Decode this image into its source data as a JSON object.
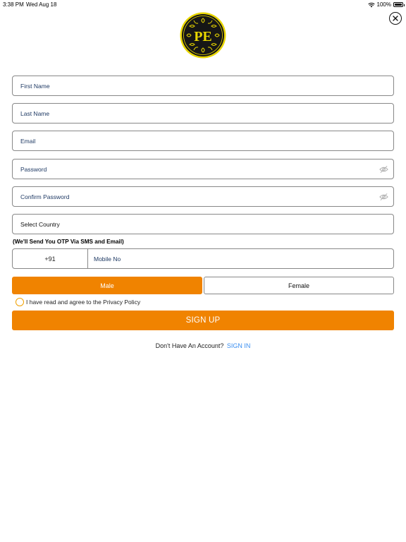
{
  "status_bar": {
    "time": "3:38 PM",
    "date": "Wed Aug 18",
    "battery_percent": "100%",
    "battery_level": 1.0
  },
  "colors": {
    "accent": "#f08300",
    "link": "#3a8ef0",
    "field_text": "#1f3a64",
    "logo_gold": "#e8d600",
    "logo_dark": "#161616"
  },
  "logo": {
    "letters": "PE"
  },
  "form": {
    "first_name_placeholder": "First Name",
    "last_name_placeholder": "Last Name",
    "email_placeholder": "Email",
    "password_placeholder": "Password",
    "confirm_password_placeholder": "Confirm Password",
    "country_select_value": "Select Country",
    "otp_note": "(We'll Send You OTP Via SMS and Email)",
    "country_code": "+91",
    "mobile_placeholder": "Mobile No",
    "gender_options": [
      "Male",
      "Female"
    ],
    "gender_selected": "Male",
    "privacy_label": "I have read and agree to the Privacy Policy",
    "signup_label": "SIGN UP"
  },
  "footer": {
    "question": "Don't Have An Account?",
    "signin_label": "SIGN IN"
  },
  "icons": [
    "wifi-icon",
    "battery-icon",
    "close-icon",
    "eye-icon",
    "logo-emblem"
  ]
}
